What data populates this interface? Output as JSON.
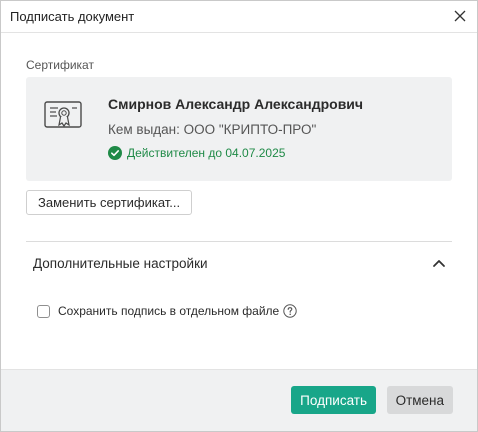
{
  "window": {
    "title": "Подписать документ",
    "close_icon": "close-icon"
  },
  "certificate": {
    "section_label": "Сертификат",
    "icon": "certificate-icon",
    "owner_name": "Смирнов Александр Александрович",
    "issuer": "Кем выдан: ООО \"КРИПТО-ПРО\"",
    "validity": "Действителен до 04.07.2025",
    "validity_icon": "check-circle-icon",
    "validity_color": "#1f8a47",
    "replace_label": "Заменить сертификат..."
  },
  "advanced": {
    "title": "Дополнительные настройки",
    "expanded": true,
    "chevron_icon": "chevron-up-icon",
    "save_separate_label": "Сохранить подпись в отдельном файле",
    "save_separate_checked": false,
    "help_icon": "help-icon"
  },
  "footer": {
    "sign_label": "Подписать",
    "cancel_label": "Отмена",
    "accent_color": "#18a689"
  }
}
